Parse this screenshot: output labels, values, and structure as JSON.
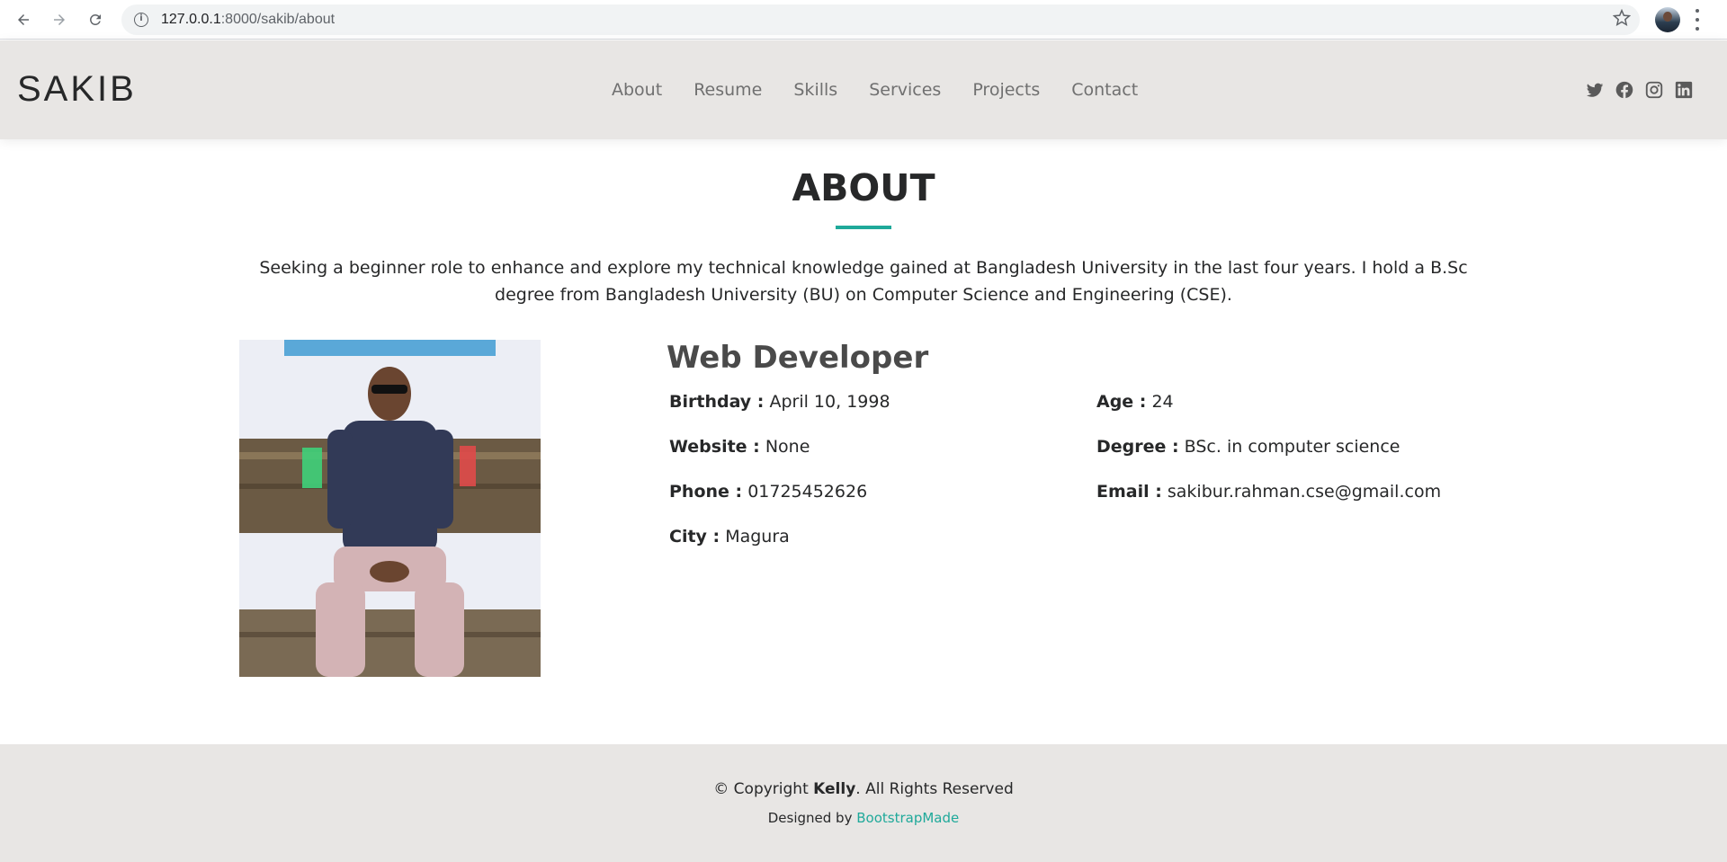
{
  "browser": {
    "url_host": "127.0.0.1",
    "url_rest": ":8000/sakib/about",
    "back_icon": "back-arrow-icon",
    "forward_icon": "forward-arrow-icon",
    "reload_icon": "reload-icon",
    "bookmark_icon": "star-icon"
  },
  "header": {
    "logo": "SAKIB",
    "nav": [
      "About",
      "Resume",
      "Skills",
      "Services",
      "Projects",
      "Contact"
    ],
    "social_icons": [
      "twitter-icon",
      "facebook-icon",
      "instagram-icon",
      "linkedin-icon"
    ]
  },
  "about": {
    "title": "ABOUT",
    "intro": "Seeking a beginner role to enhance and explore my technical knowledge gained at Bangladesh University in the last four years. I hold a B.Sc degree from Bangladesh University (BU) on Computer Science and Engineering (CSE).",
    "role": "Web Developer",
    "info": {
      "birthday_label": "Birthday :",
      "birthday": "April 10, 1998",
      "website_label": "Website :",
      "website": "None",
      "phone_label": "Phone :",
      "phone": "01725452626",
      "city_label": "City :",
      "city": "Magura",
      "age_label": "Age :",
      "age": "24",
      "degree_label": "Degree :",
      "degree": "BSc. in computer science",
      "email_label": "Email :",
      "email": "sakibur.rahman.cse@gmail.com"
    }
  },
  "footer": {
    "copyright_prefix": "© Copyright",
    "copyright_name": "Kelly",
    "copyright_suffix": ". All Rights Reserved",
    "designed_by": "Designed by",
    "designer": "BootstrapMade"
  },
  "colors": {
    "accent": "#1fa99a",
    "header_bg": "#e8e6e4"
  }
}
